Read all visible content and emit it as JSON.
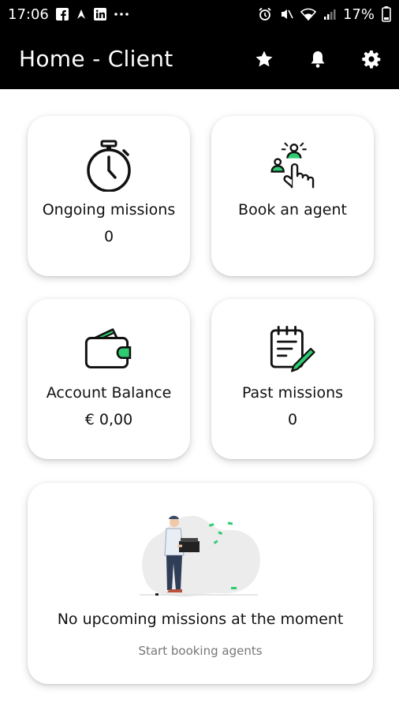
{
  "status_bar": {
    "time": "17:06",
    "battery": "17%",
    "left_icons": [
      "facebook-icon",
      "notification-icon",
      "linkedin-icon",
      "more-dots-icon"
    ],
    "right_icons": [
      "alarm-icon",
      "mute-icon",
      "wifi-icon",
      "signal-icon",
      "battery-icon"
    ]
  },
  "app_bar": {
    "title": "Home - Client",
    "actions": [
      "star-icon",
      "bell-icon",
      "gear-icon"
    ]
  },
  "cards": {
    "ongoing": {
      "label": "Ongoing missions",
      "value": "0",
      "icon": "stopwatch-icon"
    },
    "book": {
      "label": "Book an agent",
      "icon": "hand-pointer-agents-icon"
    },
    "balance": {
      "label": "Account Balance",
      "value": "€ 0,00",
      "icon": "wallet-icon"
    },
    "past": {
      "label": "Past missions",
      "value": "0",
      "icon": "notepad-pencil-icon"
    }
  },
  "upcoming": {
    "title": "No upcoming missions at the moment",
    "subtitle": "Start booking agents",
    "illustration": "delivery-person-illustration"
  },
  "colors": {
    "bar": "#000000",
    "accent": "#2ecc71",
    "card_bg": "#ffffff",
    "subtitle": "#777777"
  }
}
